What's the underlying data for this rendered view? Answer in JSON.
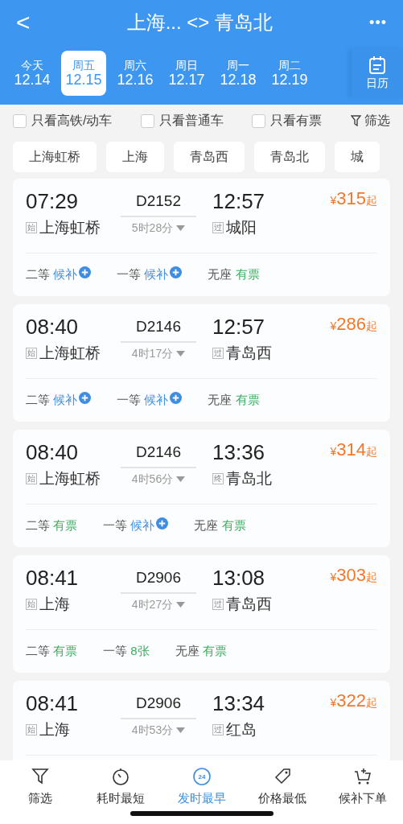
{
  "header": {
    "back": "<",
    "title": "上海... <> 青岛北",
    "more": "•••"
  },
  "dates": [
    {
      "weekday": "今天",
      "date": "12.14",
      "selected": false
    },
    {
      "weekday": "周五",
      "date": "12.15",
      "selected": true
    },
    {
      "weekday": "周六",
      "date": "12.16",
      "selected": false
    },
    {
      "weekday": "周日",
      "date": "12.17",
      "selected": false
    },
    {
      "weekday": "周一",
      "date": "12.18",
      "selected": false
    },
    {
      "weekday": "周二",
      "date": "12.19",
      "selected": false
    }
  ],
  "calendar_button": "日历",
  "filters": [
    {
      "label": "只看高铁/动车",
      "checked": false
    },
    {
      "label": "只看普通车",
      "checked": false
    },
    {
      "label": "只看有票",
      "checked": false
    }
  ],
  "filter_button": "筛选",
  "stations": [
    "上海虹桥",
    "上海",
    "青岛西",
    "青岛北",
    "城"
  ],
  "trains": [
    {
      "depart": "07:29",
      "from_tag": "始",
      "from": "上海虹桥",
      "number": "D2152",
      "duration": "5时28分",
      "arrive": "12:57",
      "to_tag": "过",
      "to": "城阳",
      "currency": "¥",
      "price": "315",
      "price_suffix": "起",
      "seats": [
        {
          "class": "二等",
          "status": "候补",
          "kind": "waitlist"
        },
        {
          "class": "一等",
          "status": "候补",
          "kind": "waitlist"
        },
        {
          "class": "无座",
          "status": "有票",
          "kind": "available"
        }
      ]
    },
    {
      "depart": "08:40",
      "from_tag": "始",
      "from": "上海虹桥",
      "number": "D2146",
      "duration": "4时17分",
      "arrive": "12:57",
      "to_tag": "过",
      "to": "青岛西",
      "currency": "¥",
      "price": "286",
      "price_suffix": "起",
      "seats": [
        {
          "class": "二等",
          "status": "候补",
          "kind": "waitlist"
        },
        {
          "class": "一等",
          "status": "候补",
          "kind": "waitlist"
        },
        {
          "class": "无座",
          "status": "有票",
          "kind": "available"
        }
      ]
    },
    {
      "depart": "08:40",
      "from_tag": "始",
      "from": "上海虹桥",
      "number": "D2146",
      "duration": "4时56分",
      "arrive": "13:36",
      "to_tag": "终",
      "to": "青岛北",
      "currency": "¥",
      "price": "314",
      "price_suffix": "起",
      "seats": [
        {
          "class": "二等",
          "status": "有票",
          "kind": "available"
        },
        {
          "class": "一等",
          "status": "候补",
          "kind": "waitlist"
        },
        {
          "class": "无座",
          "status": "有票",
          "kind": "available"
        }
      ]
    },
    {
      "depart": "08:41",
      "from_tag": "始",
      "from": "上海",
      "number": "D2906",
      "duration": "4时27分",
      "arrive": "13:08",
      "to_tag": "过",
      "to": "青岛西",
      "currency": "¥",
      "price": "303",
      "price_suffix": "起",
      "seats": [
        {
          "class": "二等",
          "status": "有票",
          "kind": "available"
        },
        {
          "class": "一等",
          "status": "8张",
          "kind": "available"
        },
        {
          "class": "无座",
          "status": "有票",
          "kind": "available"
        }
      ]
    },
    {
      "depart": "08:41",
      "from_tag": "始",
      "from": "上海",
      "number": "D2906",
      "duration": "4时53分",
      "arrive": "13:34",
      "to_tag": "过",
      "to": "红岛",
      "currency": "¥",
      "price": "322",
      "price_suffix": "起"
    }
  ],
  "bottom_nav": [
    {
      "label": "筛选",
      "kind": "funnel",
      "selected": false
    },
    {
      "label": "耗时最短",
      "kind": "timer",
      "selected": false
    },
    {
      "label": "发时最早",
      "kind": "clock24",
      "icon_text": "24",
      "selected": true
    },
    {
      "label": "价格最低",
      "kind": "tag",
      "selected": false
    },
    {
      "label": "候补下单",
      "kind": "cart",
      "selected": false
    }
  ]
}
